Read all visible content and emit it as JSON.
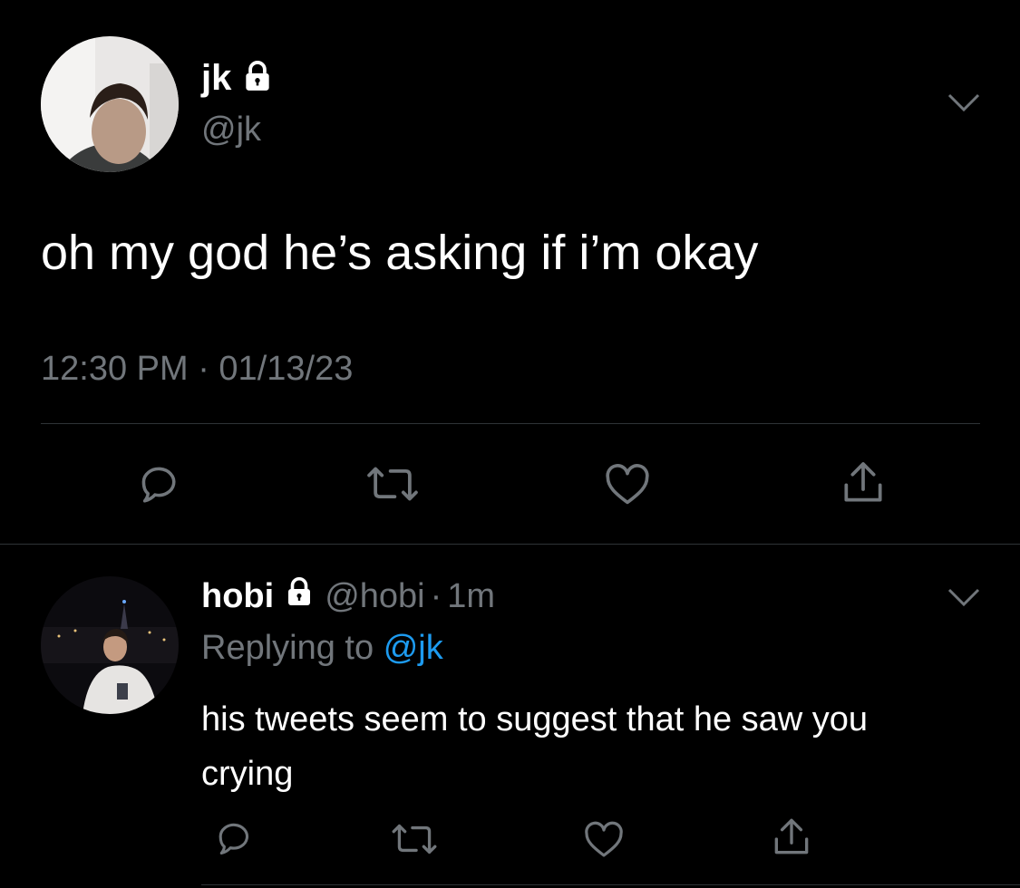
{
  "main_tweet": {
    "display_name": "jk",
    "handle": "@jk",
    "text": "oh my god he’s asking if i’m okay",
    "timestamp": "12:30 PM · 01/13/23",
    "protected": true
  },
  "reply": {
    "display_name": "hobi",
    "handle": "@hobi",
    "separator": "·",
    "time_ago": "1m",
    "replying_prefix": "Replying to",
    "replying_handle": "@jk",
    "text": "his tweets seem to suggest that he saw you crying",
    "protected": true
  },
  "icons": {
    "reply": "reply-icon",
    "retweet": "retweet-icon",
    "like": "like-icon",
    "share": "share-icon",
    "menu": "chevron-down-icon",
    "lock": "lock-icon"
  },
  "colors": {
    "background": "#000000",
    "text": "#ffffff",
    "muted": "#71767b",
    "link": "#1d9bf0",
    "divider": "#2f3336"
  }
}
